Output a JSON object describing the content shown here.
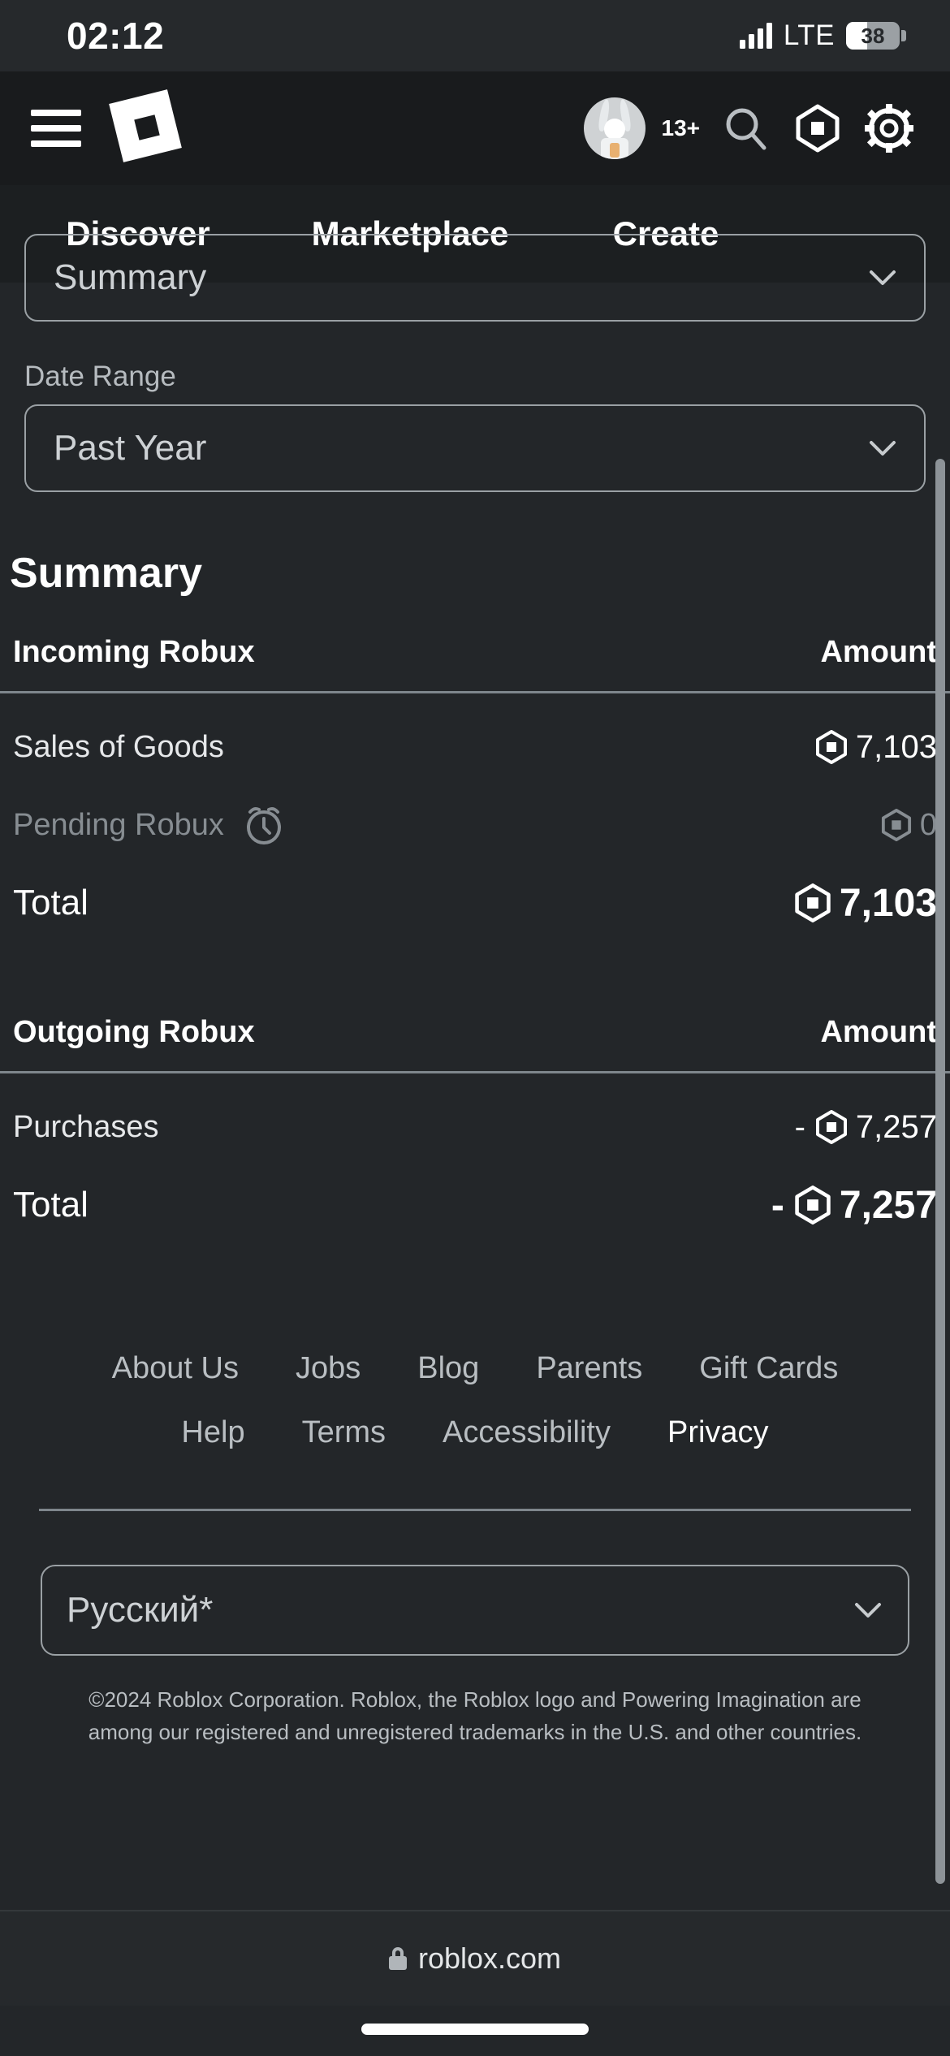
{
  "status_bar": {
    "time": "02:12",
    "network": "LTE",
    "battery_percent": "38",
    "signal_icon": "signal-bars-icon",
    "battery_icon": "battery-icon"
  },
  "header": {
    "menu_icon": "hamburger-menu-icon",
    "logo_icon": "roblox-logo-icon",
    "avatar_icon": "user-avatar-icon",
    "age_badge": "13+",
    "search_icon": "search-icon",
    "robux_icon": "robux-icon",
    "settings_icon": "gear-icon"
  },
  "nav_tabs": [
    {
      "label": "Discover",
      "name": "tab-discover"
    },
    {
      "label": "Marketplace",
      "name": "tab-marketplace"
    },
    {
      "label": "Create",
      "name": "tab-create"
    }
  ],
  "filters": {
    "report_type": {
      "value": "Summary",
      "chevron_icon": "chevron-down-icon"
    },
    "date_range": {
      "label": "Date Range",
      "value": "Past Year",
      "chevron_icon": "chevron-down-icon"
    }
  },
  "summary": {
    "title": "Summary",
    "incoming": {
      "header_label": "Incoming Robux",
      "header_amount": "Amount",
      "rows": [
        {
          "label": "Sales of Goods",
          "amount": "7,103",
          "sign": "",
          "dim": false,
          "icon": "robux-icon"
        },
        {
          "label": "Pending Robux",
          "amount": "0",
          "sign": "",
          "dim": true,
          "icon": "robux-icon",
          "extra_icon": "alarm-clock-icon"
        }
      ],
      "total": {
        "label": "Total",
        "amount": "7,103",
        "sign": ""
      }
    },
    "outgoing": {
      "header_label": "Outgoing Robux",
      "header_amount": "Amount",
      "rows": [
        {
          "label": "Purchases",
          "amount": "7,257",
          "sign": "-",
          "dim": false,
          "icon": "robux-icon"
        }
      ],
      "total": {
        "label": "Total",
        "amount": "7,257",
        "sign": "-"
      }
    }
  },
  "footer": {
    "links_row1": [
      {
        "label": "About Us",
        "bright": false
      },
      {
        "label": "Jobs",
        "bright": false
      },
      {
        "label": "Blog",
        "bright": false
      },
      {
        "label": "Parents",
        "bright": false
      },
      {
        "label": "Gift Cards",
        "bright": false
      }
    ],
    "links_row2": [
      {
        "label": "Help",
        "bright": false
      },
      {
        "label": "Terms",
        "bright": false
      },
      {
        "label": "Accessibility",
        "bright": false
      },
      {
        "label": "Privacy",
        "bright": true
      }
    ],
    "language": {
      "value": "Русский*",
      "chevron_icon": "chevron-down-icon"
    },
    "copyright": "©2024 Roblox Corporation. Roblox, the Roblox logo and Powering Imagination are among our registered and unregistered trademarks in the U.S. and other countries."
  },
  "browser": {
    "url": "roblox.com",
    "lock_icon": "lock-icon"
  },
  "colors": {
    "background": "#232629",
    "header_bg": "#191b1d",
    "navtabs_bg": "#1c1f21",
    "statusbar_bg": "#26292c",
    "text_primary": "#ffffff",
    "text_secondary": "#b9bec2",
    "text_dim": "#878d92",
    "border": "#9aa0a4"
  }
}
